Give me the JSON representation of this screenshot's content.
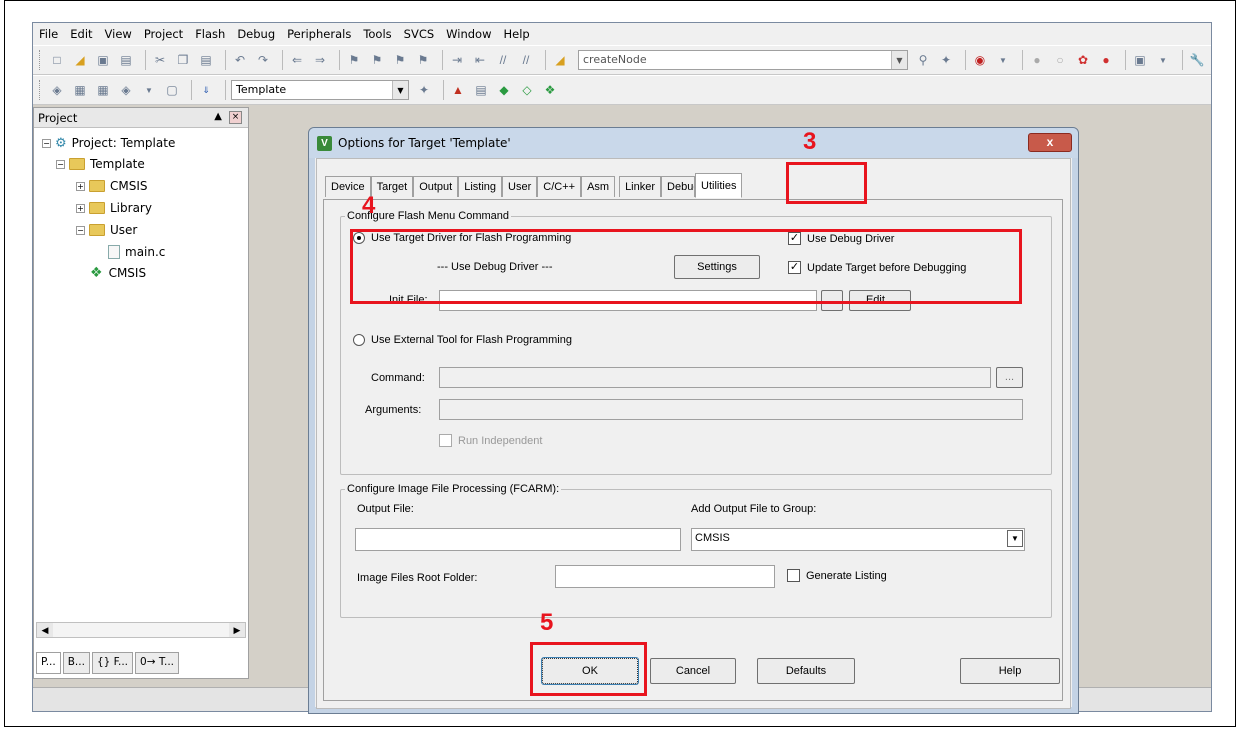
{
  "menu": [
    "File",
    "Edit",
    "View",
    "Project",
    "Flash",
    "Debug",
    "Peripherals",
    "Tools",
    "SVCS",
    "Window",
    "Help"
  ],
  "toolbar": {
    "search_value": "createNode",
    "target_value": "Template"
  },
  "project_panel": {
    "title": "Project",
    "tree": {
      "root": "Project: Template",
      "target": "Template",
      "groups": [
        "CMSIS",
        "Library",
        "User"
      ],
      "file": "main.c",
      "component": "CMSIS"
    },
    "tabs": [
      "P...",
      "B...",
      "{} F...",
      "0→ T..."
    ]
  },
  "dialog": {
    "title": "Options for Target 'Template'",
    "close_label": "x",
    "tabs": [
      "Device",
      "Target",
      "Output",
      "Listing",
      "User",
      "C/C++",
      "Asm",
      "Linker",
      "Debug",
      "Utilities"
    ],
    "active_tab": "Utilities",
    "flash_group": {
      "legend": "Configure Flash Menu Command",
      "use_target_driver": "Use Target Driver for Flash Programming",
      "driver_name": "--- Use Debug Driver ---",
      "settings_label": "Settings",
      "use_debug_driver": "Use Debug Driver",
      "update_target": "Update Target before Debugging",
      "init_file_label": "Init File:",
      "init_file_value": "",
      "browse_label": "...",
      "edit_label": "Edit...",
      "use_external": "Use External Tool for Flash Programming",
      "command_label": "Command:",
      "arguments_label": "Arguments:",
      "run_independent": "Run Independent"
    },
    "image_group": {
      "legend": "Configure Image File Processing (FCARM):",
      "output_file_label": "Output File:",
      "output_file_value": "",
      "add_output_label": "Add Output File  to Group:",
      "group_value": "CMSIS",
      "root_folder_label": "Image Files Root Folder:",
      "root_folder_value": "",
      "generate_listing": "Generate Listing"
    },
    "buttons": {
      "ok": "OK",
      "cancel": "Cancel",
      "defaults": "Defaults",
      "help": "Help"
    }
  },
  "annotations": {
    "step3": "3",
    "step4": "4",
    "step5": "5"
  },
  "colors": {
    "annotation": "#e8141e",
    "dialog_title_bg": "#c9d8ea"
  }
}
